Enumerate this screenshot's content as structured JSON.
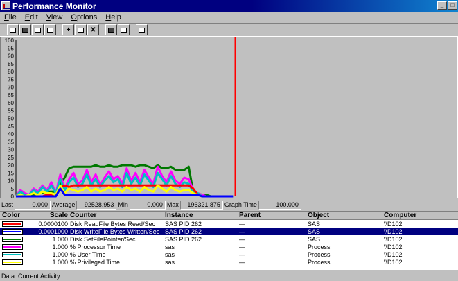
{
  "window": {
    "title": "Performance Monitor"
  },
  "menu": [
    "File",
    "Edit",
    "View",
    "Options",
    "Help"
  ],
  "toolbar": {
    "buttons": [
      "chart-view",
      "alert-view",
      "log-view",
      "report-view",
      "add-counter",
      "edit-counter",
      "delete-counter",
      "update-now",
      "bookmark",
      "options"
    ]
  },
  "chart_data": {
    "type": "line",
    "title": "",
    "xlabel": "",
    "ylabel": "",
    "ylim": [
      0,
      100
    ],
    "y_ticks": [
      "100",
      "95",
      "90",
      "85",
      "80",
      "75",
      "70",
      "65",
      "60",
      "55",
      "50",
      "45",
      "40",
      "35",
      "30",
      "25",
      "20",
      "15",
      "10",
      "5",
      "0"
    ],
    "grid": false,
    "time_marker_fraction": 0.5,
    "samples": 100,
    "series": [
      {
        "color": "#007800",
        "values": [
          0,
          0,
          1,
          1,
          1,
          2,
          2,
          3,
          3,
          3,
          8,
          12,
          18,
          19,
          19,
          19,
          19,
          19,
          20,
          19,
          19,
          20,
          19,
          19,
          20,
          20,
          20,
          19,
          20,
          20,
          19,
          18,
          20,
          18,
          18,
          19,
          17,
          17,
          17,
          19,
          3,
          2,
          1,
          1,
          0,
          0,
          0,
          0,
          0,
          0
        ]
      },
      {
        "color": "#ff00ff",
        "values": [
          0,
          4,
          2,
          1,
          5,
          3,
          7,
          4,
          9,
          2,
          14,
          5,
          11,
          15,
          8,
          10,
          17,
          9,
          14,
          7,
          12,
          16,
          11,
          13,
          8,
          18,
          10,
          15,
          9,
          17,
          12,
          8,
          19,
          13,
          9,
          16,
          10,
          8,
          12,
          11,
          4,
          2,
          1,
          0,
          0,
          0,
          0,
          0,
          0,
          0
        ]
      },
      {
        "color": "#00c0c0",
        "values": [
          0,
          3,
          1,
          1,
          4,
          2,
          6,
          3,
          7,
          2,
          11,
          4,
          9,
          12,
          6,
          8,
          14,
          7,
          11,
          6,
          10,
          13,
          9,
          11,
          6,
          15,
          8,
          12,
          7,
          14,
          10,
          6,
          15,
          11,
          7,
          13,
          8,
          6,
          9,
          8,
          3,
          2,
          0,
          0,
          0,
          0,
          0,
          0,
          0,
          0
        ]
      },
      {
        "color": "#ff0000",
        "values": [
          0,
          0,
          0,
          0,
          0,
          0,
          0,
          1,
          1,
          1,
          6,
          7,
          6,
          7,
          7,
          7,
          7,
          7,
          7,
          7,
          7,
          7,
          7,
          7,
          7,
          7,
          7,
          7,
          7,
          7,
          7,
          7,
          7,
          7,
          7,
          7,
          7,
          7,
          7,
          7,
          5,
          1,
          0,
          0,
          0,
          0,
          0,
          0,
          0,
          0
        ]
      },
      {
        "color": "#ffff00",
        "values": [
          0,
          1,
          0,
          1,
          2,
          1,
          3,
          2,
          2,
          1,
          7,
          2,
          5,
          4,
          3,
          4,
          6,
          3,
          5,
          3,
          4,
          6,
          4,
          5,
          3,
          6,
          4,
          5,
          3,
          6,
          4,
          3,
          7,
          5,
          3,
          6,
          4,
          3,
          4,
          4,
          2,
          1,
          0,
          0,
          0,
          0,
          0,
          0,
          0,
          0
        ]
      },
      {
        "color": "#0000ff",
        "values": [
          0,
          0,
          0,
          0,
          0,
          0,
          0,
          0,
          0,
          0,
          5,
          1,
          1,
          1,
          1,
          1,
          1,
          1,
          1,
          1,
          1,
          1,
          1,
          1,
          1,
          1,
          1,
          1,
          1,
          1,
          1,
          1,
          1,
          1,
          1,
          1,
          1,
          1,
          1,
          1,
          1,
          1,
          0,
          0,
          0,
          0,
          0,
          0,
          0,
          0
        ]
      }
    ]
  },
  "stats": {
    "last_label": "Last",
    "last": "0.000",
    "average_label": "Average",
    "average": "92528.953",
    "min_label": "Min",
    "min": "0.000",
    "max_label": "Max",
    "max": "196321.875",
    "graph_time_label": "Graph Time",
    "graph_time": "100.000"
  },
  "legend": {
    "headers": {
      "color": "Color",
      "scale": "Scale",
      "counter": "Counter",
      "instance": "Instance",
      "parent": "Parent",
      "object": "Object",
      "computer": "Computer"
    },
    "rows": [
      {
        "color": "#ff0000",
        "scale": "0.0000100",
        "counter": "Disk ReadFile Bytes Read/Sec",
        "instance": "SAS PID 262",
        "parent": "—",
        "object": "SAS",
        "computer": "\\\\D102",
        "selected": false
      },
      {
        "color": "#0000ff",
        "scale": "0.0001000",
        "counter": "Disk WriteFile Bytes Written/Sec",
        "instance": "SAS PID 262",
        "parent": "—",
        "object": "SAS",
        "computer": "\\\\D102",
        "selected": true
      },
      {
        "color": "#007800",
        "scale": "1.000",
        "counter": "Disk SetFilePointer/Sec",
        "instance": "SAS PID 262",
        "parent": "—",
        "object": "SAS",
        "computer": "\\\\D102",
        "selected": false
      },
      {
        "color": "#ff00ff",
        "scale": "1.000",
        "counter": "% Processor Time",
        "instance": "sas",
        "parent": "—",
        "object": "Process",
        "computer": "\\\\D102",
        "selected": false
      },
      {
        "color": "#00c0c0",
        "scale": "1.000",
        "counter": "% User Time",
        "instance": "sas",
        "parent": "—",
        "object": "Process",
        "computer": "\\\\D102",
        "selected": false
      },
      {
        "color": "#ffff00",
        "scale": "1.000",
        "counter": "% Privileged Time",
        "instance": "sas",
        "parent": "—",
        "object": "Process",
        "computer": "\\\\D102",
        "selected": false
      }
    ]
  },
  "status": {
    "text": "Data: Current Activity"
  }
}
